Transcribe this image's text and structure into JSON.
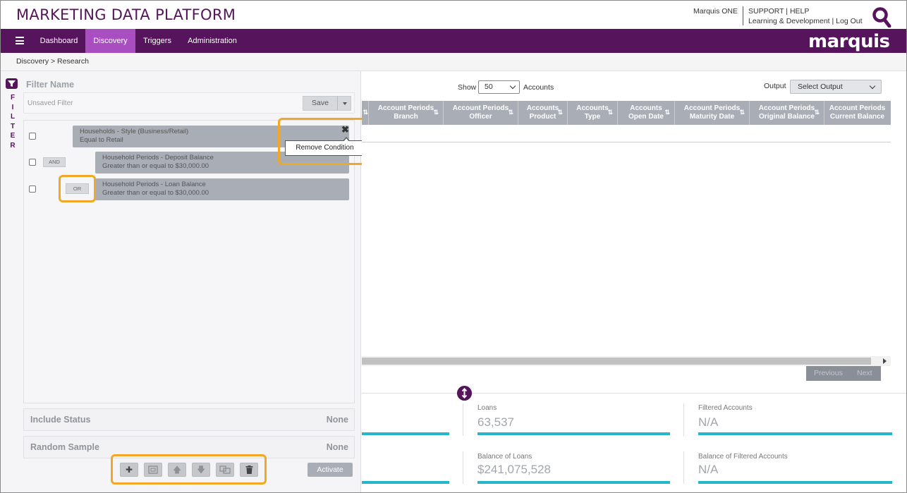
{
  "header": {
    "title": "MARKETING DATA PLATFORM",
    "user_link": "Marquis ONE",
    "support_line": "SUPPORT | HELP",
    "learning_line": "Learning & Development | Log Out"
  },
  "nav": {
    "items": [
      "Dashboard",
      "Discovery",
      "Triggers",
      "Administration"
    ],
    "active": "Discovery",
    "logo": "marquis"
  },
  "breadcrumb": "Discovery  >  Research",
  "filter": {
    "side_letters": [
      "F",
      "I",
      "L",
      "T",
      "E",
      "R"
    ],
    "name_label": "Filter Name",
    "name_value": "Unsaved Filter",
    "save_label": "Save",
    "conditions": [
      {
        "line1": "Households - Style (Business/Retail)",
        "line2": "Equal to Retail"
      },
      {
        "line1": "Household Periods - Deposit Balance",
        "line2": "Greater than or equal to $30,000.00",
        "operator": "AND"
      },
      {
        "line1": "Household Periods - Loan Balance",
        "line2": "Greater than or equal to $30,000.00",
        "operator": "OR"
      }
    ],
    "tooltip": "Remove Condition",
    "include_status": {
      "label": "Include Status",
      "value": "None"
    },
    "random_sample": {
      "label": "Random Sample",
      "value": "None"
    },
    "activate_label": "Activate",
    "toolbar_icons": [
      "plus-icon",
      "group-icon",
      "arrow-up-icon",
      "arrow-down-icon",
      "ungroup-icon",
      "trash-icon"
    ]
  },
  "results": {
    "show_label": "Show",
    "show_value": "50",
    "accounts_label": "Accounts",
    "output_label": "Output",
    "output_value": "Select Output",
    "columns": [
      {
        "l1": "Account Periods",
        "l2": "Branch"
      },
      {
        "l1": "Account Periods",
        "l2": "Officer"
      },
      {
        "l1": "Accounts",
        "l2": "Product"
      },
      {
        "l1": "Accounts",
        "l2": "Type"
      },
      {
        "l1": "Accounts",
        "l2": "Open Date"
      },
      {
        "l1": "Account Periods",
        "l2": "Maturity Date"
      },
      {
        "l1": "Account Periods",
        "l2": "Original Balance"
      },
      {
        "l1": "Account Periods",
        "l2": "Current Balance"
      }
    ],
    "pager": {
      "previous": "Previous",
      "next": "Next"
    }
  },
  "stats": [
    {
      "label": "Loans",
      "value": "63,537"
    },
    {
      "label": "Filtered Accounts",
      "value": "N/A"
    },
    {
      "label": "Balance of Loans",
      "value": "$241,075,528"
    },
    {
      "label": "Balance of Filtered Accounts",
      "value": "N/A"
    }
  ],
  "colors": {
    "brand": "#55145b",
    "active_tab": "#a84ec0",
    "highlight": "#f0a826",
    "stat_bar": "#26b6cc"
  }
}
